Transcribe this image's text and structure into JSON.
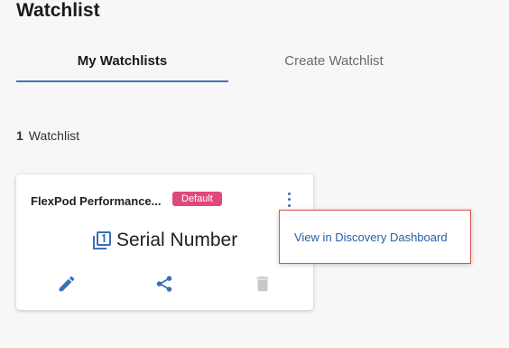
{
  "header": {
    "title": "Watchlist"
  },
  "tabs": [
    {
      "label": "My Watchlists",
      "active": true
    },
    {
      "label": "Create Watchlist",
      "active": false
    }
  ],
  "summary": {
    "count": "1",
    "label": "Watchlist"
  },
  "card": {
    "name": "FlexPod Performance...",
    "badge": "Default",
    "metric_icon": "numbered-list-icon",
    "metric_label": "Serial Number",
    "actions": [
      "pencil-icon",
      "share-icon",
      "trash-icon"
    ]
  },
  "menu": {
    "items": [
      {
        "label": "View in Discovery Dashboard"
      }
    ]
  },
  "colors": {
    "accent": "#4273b8",
    "badge_bg": "#e1487a",
    "link": "#2a5ea8",
    "highlight_border": "#d9534f",
    "disabled_icon": "#c8c8c8"
  }
}
